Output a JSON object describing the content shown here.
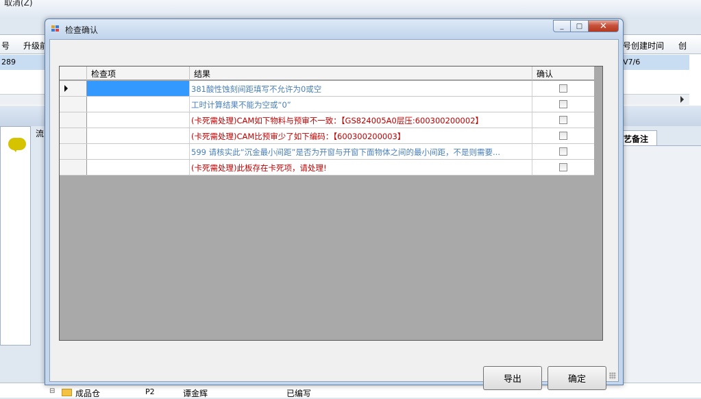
{
  "background": {
    "top_label": "取消(Z)",
    "grid_headers": [
      "号",
      "升级前",
      "号创建时间",
      "创"
    ],
    "grid_row_values": [
      "289",
      "V7/6"
    ],
    "left_label": "流",
    "right_tab": "艺备注",
    "bottom_row": [
      "成品仓",
      "P2",
      "谭金辉",
      "已编写"
    ]
  },
  "dialog": {
    "title": "检查确认",
    "buttons": {
      "minimize": "_",
      "maximize": "□",
      "close": "✕"
    },
    "grid": {
      "columns": [
        "检查项",
        "结果",
        "确认"
      ],
      "rows": [
        {
          "item": "",
          "result": "381酸性蚀刻间距填写不允许为0或空",
          "style": "blue",
          "checked": false,
          "selected": true
        },
        {
          "item": "",
          "result": "工时计算结果不能为空或“0”",
          "style": "blue",
          "checked": false,
          "selected": false
        },
        {
          "item": "",
          "result": "(卡死需处理)CAM如下物料与预审不一致：【GS824005A0层压:600300200002】",
          "style": "red",
          "checked": false,
          "selected": false
        },
        {
          "item": "",
          "result": "(卡死需处理)CAM比预审少了如下编码：【600300200003】",
          "style": "red",
          "checked": false,
          "selected": false
        },
        {
          "item": "",
          "result": "599 请核实此“沉金最小间距”是否为开窗与开窗下面物体之间的最小间距，不是则需要...",
          "style": "blue",
          "checked": false,
          "selected": false
        },
        {
          "item": "",
          "result": "(卡死需处理)此板存在卡死项，请处理!",
          "style": "red",
          "checked": false,
          "selected": false
        }
      ]
    },
    "export_label": "导出",
    "ok_label": "确定"
  },
  "colors": {
    "selection": "#3399ff",
    "warning_red": "#c00000",
    "info_blue": "#4a7fb8",
    "grid_empty": "#a9a9a9"
  }
}
